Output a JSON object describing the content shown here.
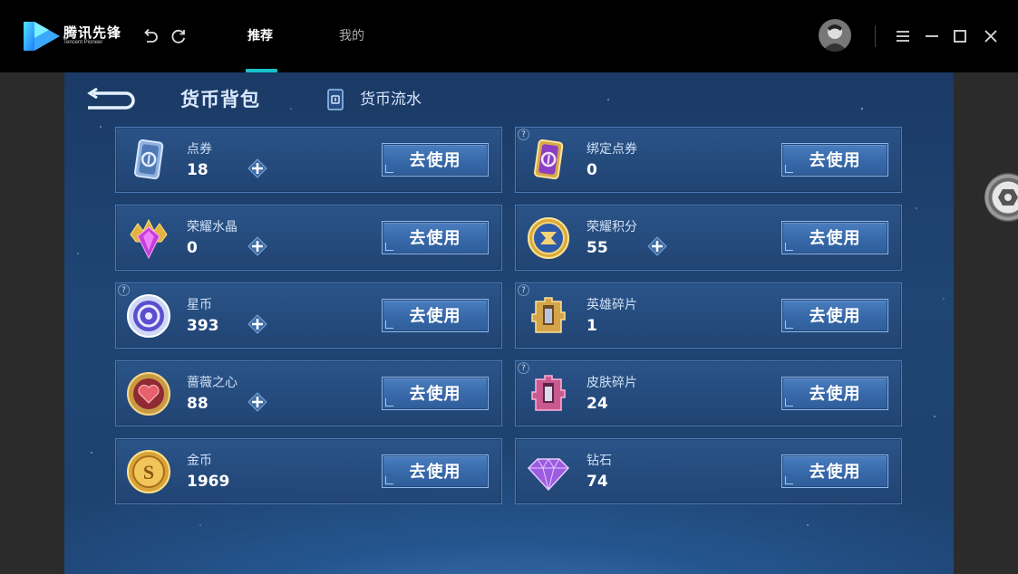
{
  "app": {
    "logo_cn": "腾讯先锋",
    "logo_en": "Tencent Pioneer",
    "accent_color": "#17c3c9"
  },
  "nav": {
    "back_icon": "undo-icon",
    "refresh_icon": "refresh-icon",
    "tabs": [
      {
        "label": "推荐",
        "active": true
      },
      {
        "label": "我的",
        "active": false
      }
    ]
  },
  "window_controls": {
    "menu_icon": "hamburger-menu-icon",
    "minimize_icon": "minimize-icon",
    "maximize_icon": "maximize-icon",
    "close_icon": "close-icon"
  },
  "panel": {
    "title": "货币背包",
    "flow_label": "货币流水",
    "button_label": "去使用",
    "help_mark": "?"
  },
  "currencies": [
    {
      "name": "点券",
      "value": "18",
      "icon": "voucher-card-icon",
      "has_plus": true,
      "has_help": false
    },
    {
      "name": "绑定点券",
      "value": "0",
      "icon": "bound-voucher-card-icon",
      "has_plus": false,
      "has_help": true
    },
    {
      "name": "荣耀水晶",
      "value": "0",
      "icon": "glory-crystal-icon",
      "has_plus": true,
      "has_help": false
    },
    {
      "name": "荣耀积分",
      "value": "55",
      "icon": "glory-points-icon",
      "has_plus": true,
      "has_help": false
    },
    {
      "name": "星币",
      "value": "393",
      "icon": "star-coin-icon",
      "has_plus": true,
      "has_help": true
    },
    {
      "name": "英雄碎片",
      "value": "1",
      "icon": "hero-fragment-icon",
      "has_plus": false,
      "has_help": true
    },
    {
      "name": "蔷薇之心",
      "value": "88",
      "icon": "rose-heart-icon",
      "has_plus": true,
      "has_help": false
    },
    {
      "name": "皮肤碎片",
      "value": "24",
      "icon": "skin-fragment-icon",
      "has_plus": false,
      "has_help": true
    },
    {
      "name": "金币",
      "value": "1969",
      "icon": "gold-coin-icon",
      "has_plus": false,
      "has_help": false
    },
    {
      "name": "钻石",
      "value": "74",
      "icon": "diamond-icon",
      "has_plus": false,
      "has_help": false
    }
  ]
}
